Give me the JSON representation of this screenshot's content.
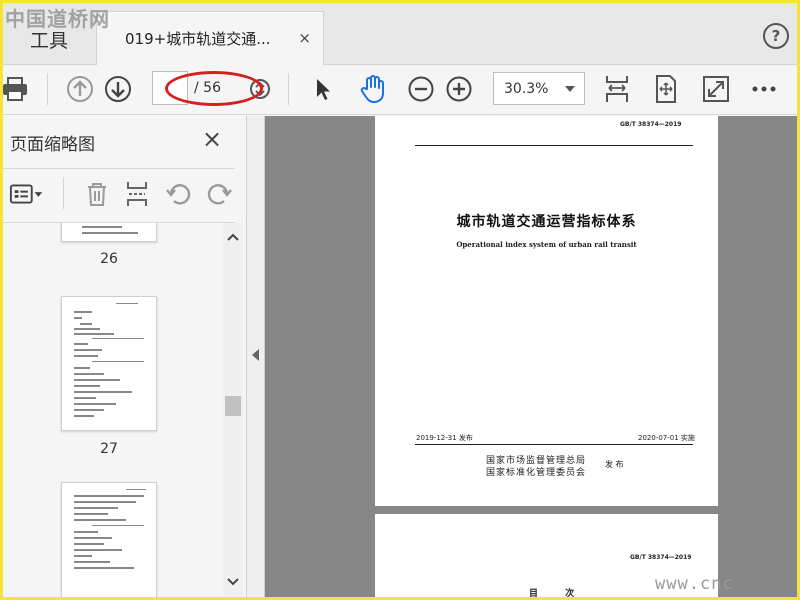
{
  "watermarks": {
    "top": "中国道桥网",
    "bottom": "www.cnc"
  },
  "tabbar": {
    "tools_label": "工具",
    "doc_tab_title": "019+城市轨道交通...",
    "close_symbol": "×",
    "help_symbol": "?"
  },
  "toolbar": {
    "page_current": "",
    "page_total": "/ 56",
    "zoom": "30.3%"
  },
  "sidebar": {
    "title": "页面缩略图",
    "close_symbol": "×",
    "thumbnails": [
      {
        "label": "26"
      },
      {
        "label": "27"
      },
      {
        "label": ""
      }
    ]
  },
  "document": {
    "page1": {
      "std_number": "GB/T 38374—2019",
      "title_cn": "城市轨道交通运营指标体系",
      "title_en": "Operational index system of urban rail transit",
      "release_date": "2019-12-31 发布",
      "effective_date": "2020-07-01 实施",
      "org_line1": "国家市场监督管理总局",
      "org_line2": "国家标准化管理委员会",
      "publish_word": "发 布"
    },
    "page2": {
      "std_number": "GB/T 38374—2019",
      "toc_title": "目 次"
    }
  },
  "colors": {
    "frame_border": "#f2e633",
    "annotation_red": "#d61f1f",
    "hand_tool_blue": "#1a73d9",
    "document_background": "#878787"
  }
}
